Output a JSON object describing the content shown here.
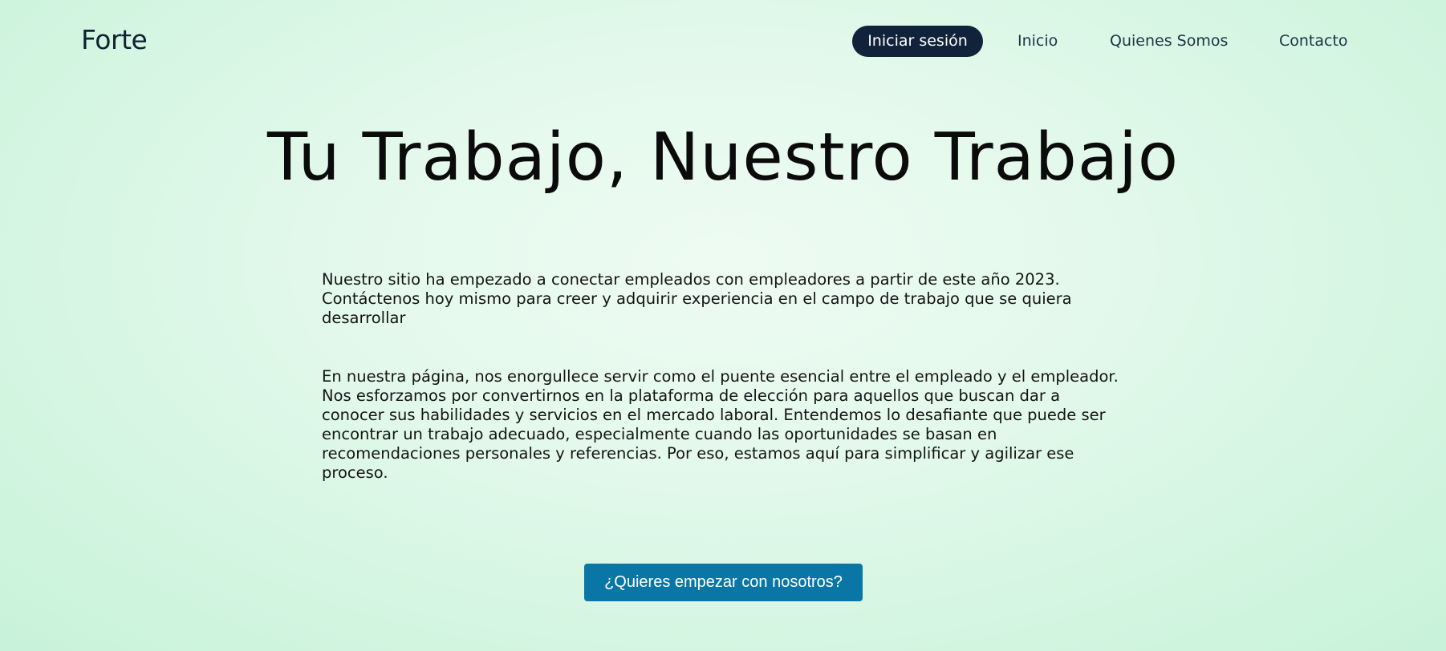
{
  "header": {
    "logo": "Forte",
    "nav": {
      "login_label": "Iniciar sesión",
      "items": [
        {
          "label": "Inicio"
        },
        {
          "label": "Quienes Somos"
        },
        {
          "label": "Contacto"
        }
      ]
    }
  },
  "hero": {
    "title": "Tu Trabajo, Nuestro Trabajo"
  },
  "main": {
    "paragraphs": [
      "Nuestro sitio ha empezado a conectar empleados con empleadores a partir de este año 2023. Contáctenos hoy mismo para creer y adquirir experiencia en el campo de trabajo que se quiera desarrollar",
      "En nuestra página, nos enorgullece servir como el puente esencial entre el empleado y el empleador. Nos esforzamos por convertirnos en la plataforma de elección para aquellos que buscan dar a conocer sus habilidades y servicios en el mercado laboral. Entendemos lo desafiante que puede ser encontrar un trabajo adecuado, especialmente cuando las oportunidades se basan en recomendaciones personales y referencias. Por eso, estamos aquí para simplificar y agilizar ese proceso."
    ],
    "cta_label": "¿Quieres empezar con nosotros?"
  },
  "colors": {
    "nav_pill": "#11233a",
    "cta": "#0a76a6",
    "background": "#dff8ea"
  }
}
